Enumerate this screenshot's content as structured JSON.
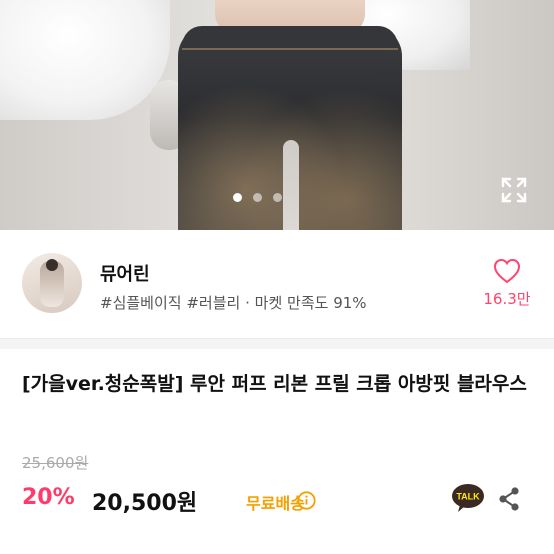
{
  "gallery": {
    "page_count": 3,
    "active_index": 0,
    "expand_icon": "expand-icon"
  },
  "shop": {
    "name": "뮤어린",
    "tags": "#심플베이직 #러블리",
    "separator": "·",
    "satisfaction": "마켓 만족도 91%",
    "like_icon": "heart-outline-icon",
    "like_count": "16.3만",
    "accent_color": "#ff4470"
  },
  "product": {
    "title": "[가을ver.청순폭발] 루안 퍼프 리본 프릴 크롭 아방핏 블라우스",
    "original_price": "25,600원",
    "discount": "20%",
    "price": "20,500원",
    "shipping": "무료배송",
    "shipping_color": "#f5a000",
    "discount_color": "#ff3b6b"
  },
  "actions": {
    "talk_label": "TALK",
    "talk_icon": "kakaotalk-icon",
    "share_icon": "share-icon",
    "info_icon": "info-icon"
  }
}
